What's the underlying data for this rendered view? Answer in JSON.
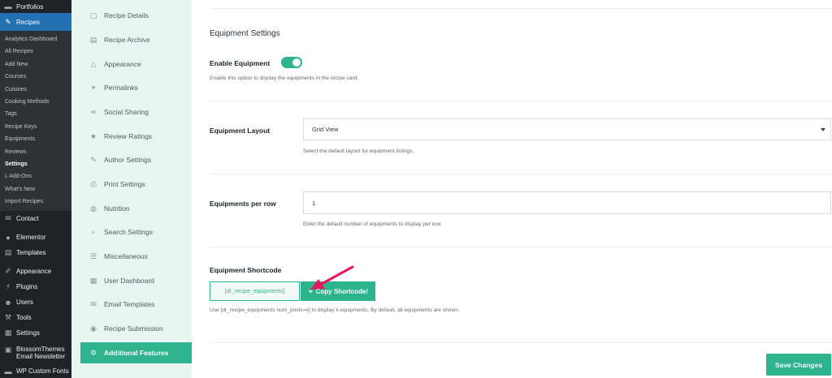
{
  "wp_menu": {
    "top_items": [
      {
        "label": "Portfolios",
        "icon": "portfolio-icon"
      },
      {
        "label": "Recipes",
        "icon": "recipe-icon"
      },
      {
        "label": "Contact",
        "icon": "mail-icon"
      },
      {
        "label": "Elementor",
        "icon": "elementor-icon"
      },
      {
        "label": "Templates",
        "icon": "templates-icon"
      },
      {
        "label": "Appearance",
        "icon": "paintbrush-icon"
      },
      {
        "label": "Plugins",
        "icon": "plugin-icon"
      },
      {
        "label": "Users",
        "icon": "user-icon"
      },
      {
        "label": "Tools",
        "icon": "wrench-icon"
      },
      {
        "label": "Settings",
        "icon": "settings-icon"
      },
      {
        "label": "BlossomThemes Email Newsletter",
        "icon": "newsletter-icon"
      },
      {
        "label": "WP Custom Fonts",
        "icon": "font-icon"
      }
    ],
    "recipes_submenu": [
      "Analytics Dashboard",
      "All Recipes",
      "Add New",
      "Courses",
      "Cuisines",
      "Cooking Methods",
      "Tags",
      "Recipe Keys",
      "Equipments",
      "Reviews",
      "Settings",
      "L Add-Ons",
      "What's New",
      "Import Recipes"
    ],
    "active_submenu": "Settings"
  },
  "settings_nav": {
    "items": [
      {
        "label": "Recipe Details",
        "icon": "file-icon"
      },
      {
        "label": "Recipe Archive",
        "icon": "archive-icon"
      },
      {
        "label": "Appearance",
        "icon": "appearance-icon"
      },
      {
        "label": "Permalinks",
        "icon": "link-icon"
      },
      {
        "label": "Social Sharing",
        "icon": "share-icon"
      },
      {
        "label": "Review Ratings",
        "icon": "star-icon"
      },
      {
        "label": "Author Settings",
        "icon": "author-icon"
      },
      {
        "label": "Print Settings",
        "icon": "print-icon"
      },
      {
        "label": "Nutrition",
        "icon": "nutrition-icon"
      },
      {
        "label": "Search Settings",
        "icon": "search-icon"
      },
      {
        "label": "Miscellaneous",
        "icon": "menu-icon"
      },
      {
        "label": "User Dashboard",
        "icon": "dashboard-icon"
      },
      {
        "label": "Email Templates",
        "icon": "email-icon"
      },
      {
        "label": "Recipe Submission",
        "icon": "submission-icon"
      },
      {
        "label": "Additional Features",
        "icon": "gear-icon"
      }
    ],
    "active": "Additional Features"
  },
  "main": {
    "section_title": "Equipment Settings",
    "enable_equipment": {
      "label": "Enable Equipment",
      "enabled": true,
      "help": "Enable this option to display the equipments in the recipe card."
    },
    "equipment_layout": {
      "label": "Equipment Layout",
      "value": "Grid View",
      "help": "Select the default layout for equipment listings."
    },
    "equipments_per_row": {
      "label": "Equipments per row",
      "value": "1",
      "help": "Enter the default number of equipments to display per row."
    },
    "equipment_shortcode": {
      "label": "Equipment Shortcode",
      "shortcode": "[dr_recipe_equipments]",
      "copy_label": "Copy Shortcode!",
      "help": "Use [dr_recipe_equipments num_posts=x] to display x equipments. By default, all equipments are shown."
    },
    "save_label": "Save Changes"
  },
  "colors": {
    "accent": "#2db38e",
    "wp_sidebar": "#1d2327",
    "wp_active": "#2271b1",
    "nav_bg": "#e8f6f1",
    "annotation_arrow": "#e8195a"
  }
}
